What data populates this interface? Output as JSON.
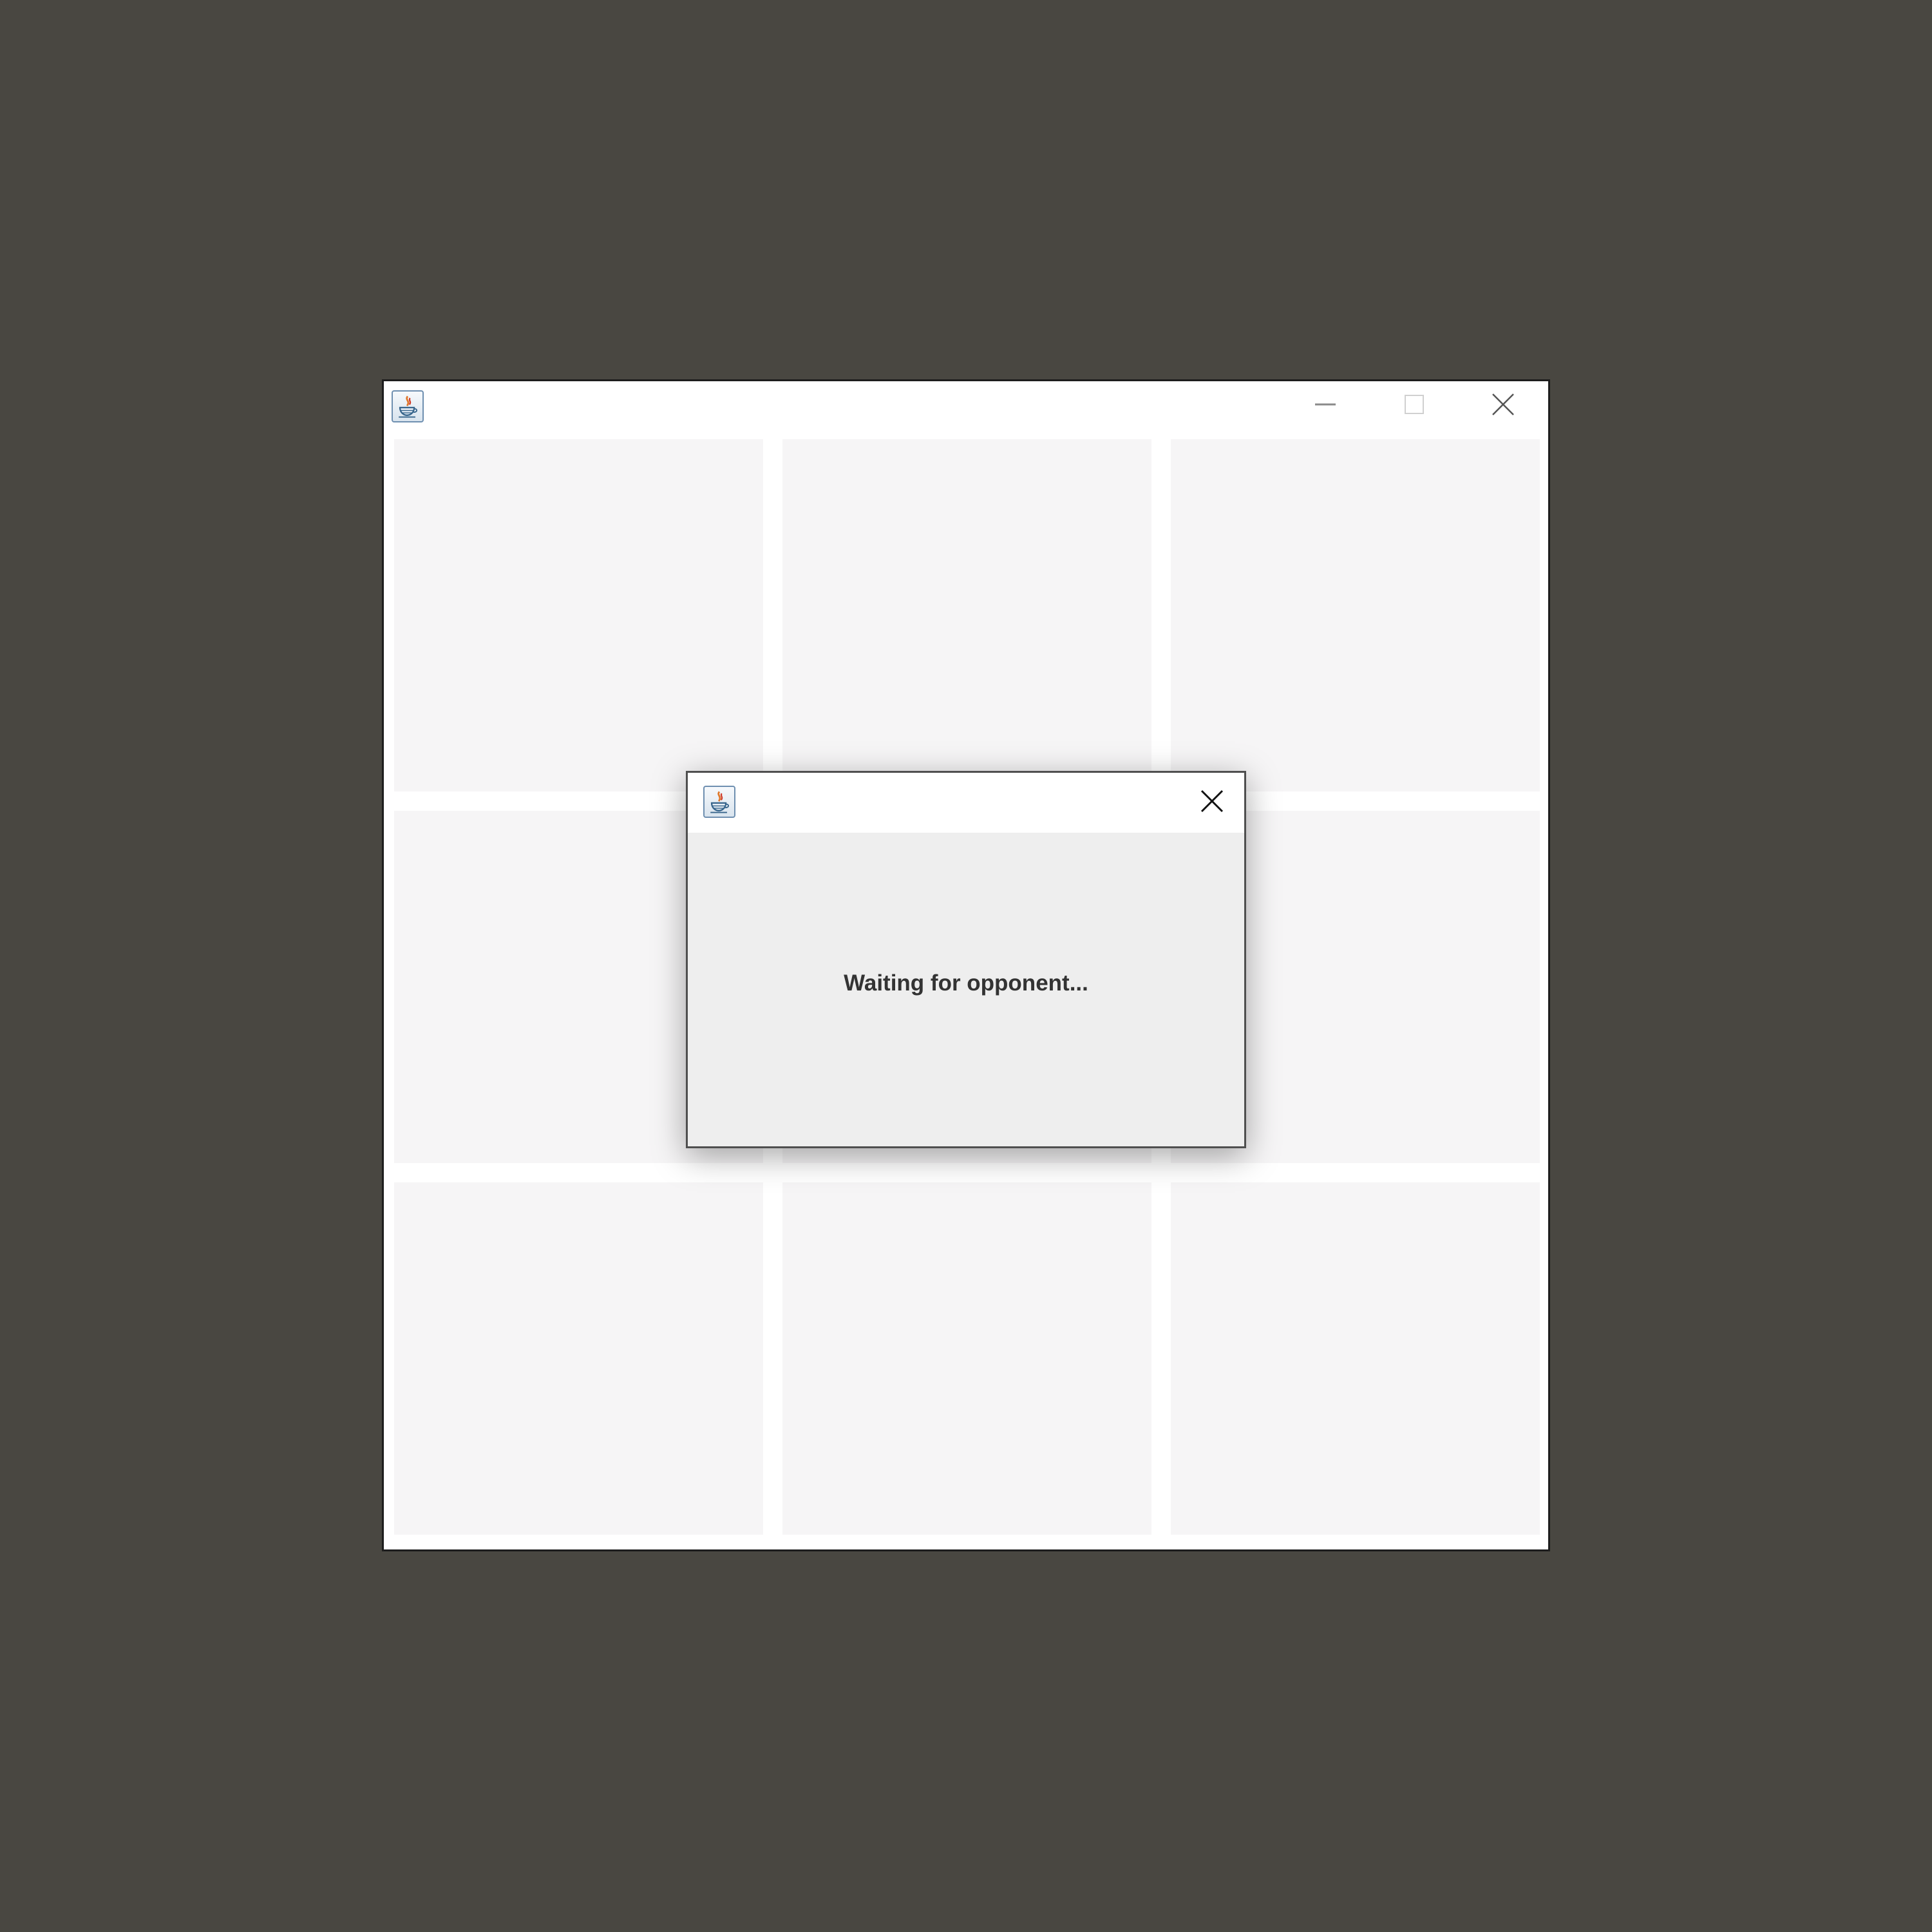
{
  "main_window": {
    "title": "",
    "icon": "java-coffee-cup-icon",
    "controls": {
      "minimize": "minimize-icon",
      "maximize": "maximize-icon",
      "close": "close-icon"
    },
    "board": {
      "rows": 3,
      "columns": 3,
      "cells": [
        "",
        "",
        "",
        "",
        "",
        "",
        "",
        "",
        ""
      ]
    }
  },
  "dialog": {
    "title": "",
    "icon": "java-coffee-cup-icon",
    "close": "close-icon",
    "message": "Waiting for opponent..."
  },
  "colors": {
    "desktop": "#494741",
    "cell": "#f6f5f6",
    "dialog_body": "#eeeeee",
    "text": "#333333"
  }
}
